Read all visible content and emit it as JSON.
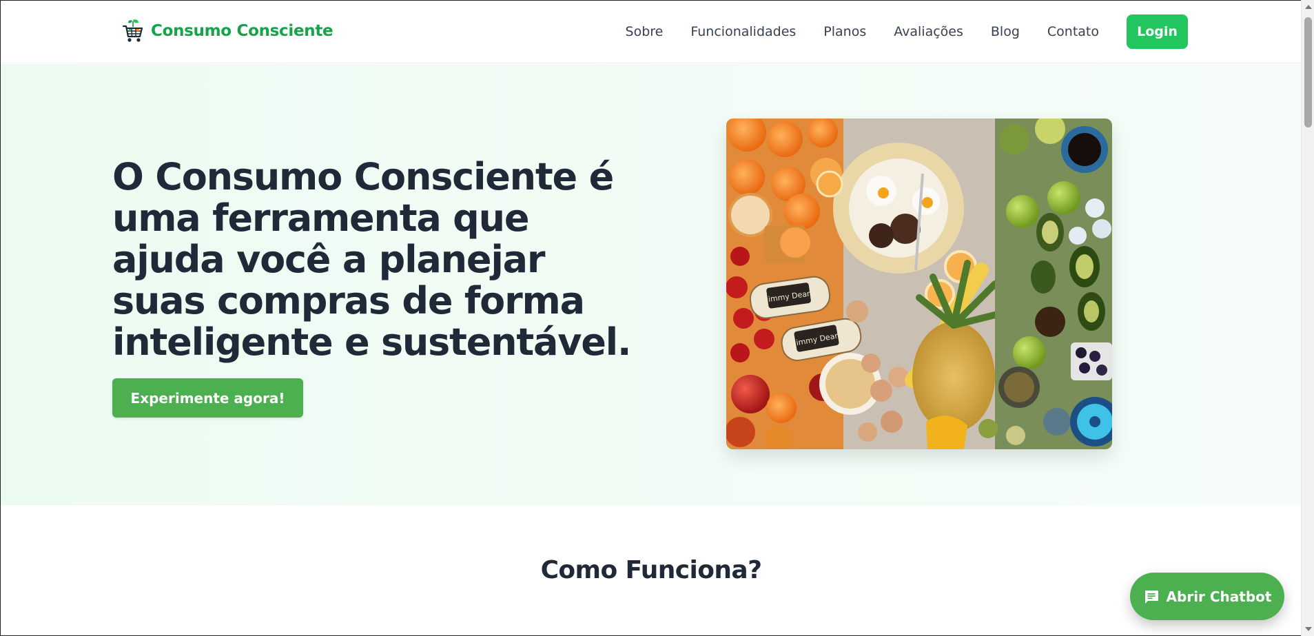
{
  "brand": {
    "name": "Consumo Consciente",
    "icon": "shopping-cart-leaf-icon",
    "color": "#16a34a"
  },
  "nav": {
    "items": [
      {
        "label": "Sobre"
      },
      {
        "label": "Funcionalidades"
      },
      {
        "label": "Planos"
      },
      {
        "label": "Avaliações"
      },
      {
        "label": "Blog"
      },
      {
        "label": "Contato"
      }
    ],
    "login_label": "Login",
    "login_color": "#22c55e"
  },
  "hero": {
    "title": "O Consumo Consciente é uma ferramenta que ajuda você a planejar suas compras de forma inteligente e sustentável.",
    "cta_label": "Experimente agora!",
    "cta_color": "#4caf50",
    "image_icon": "food-spread-photo"
  },
  "section": {
    "title": "Como Funciona?"
  },
  "chatbot": {
    "label": "Abrir Chatbot",
    "icon": "chat-bubble-icon",
    "color": "#4caf50"
  }
}
